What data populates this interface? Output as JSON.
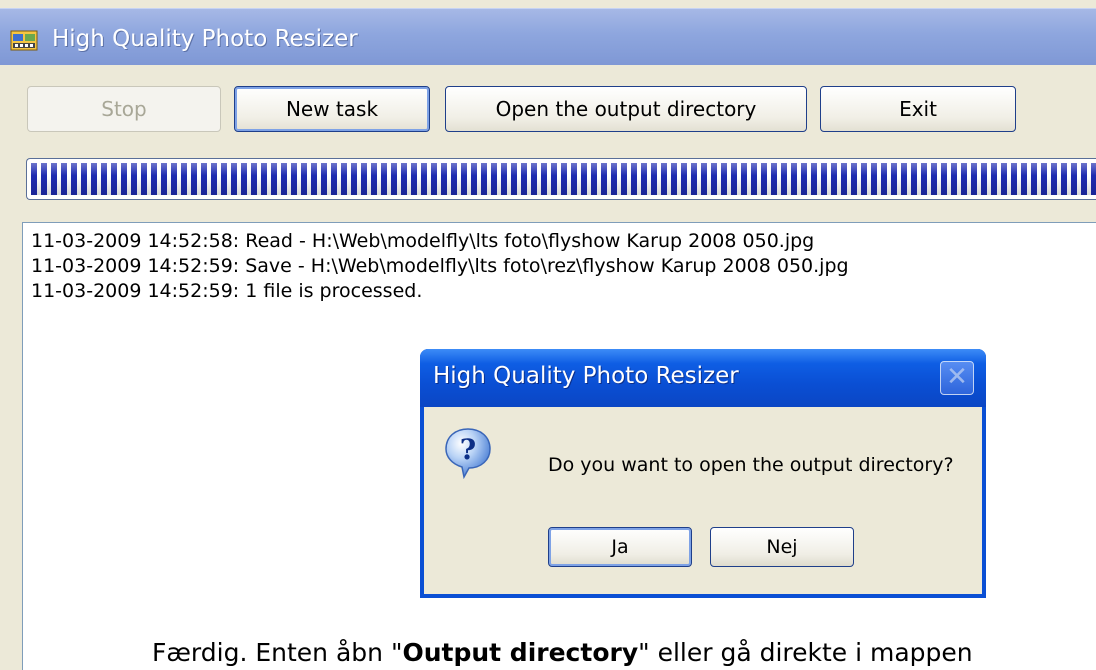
{
  "window": {
    "title": "High Quality Photo Resizer"
  },
  "toolbar": {
    "stop_label": "Stop",
    "new_task_label": "New task",
    "open_output_label": "Open the output directory",
    "exit_label": "Exit"
  },
  "progress": {
    "value_percent": 100
  },
  "log": {
    "lines": [
      "11-03-2009 14:52:58: Read - H:\\Web\\modelfly\\lts foto\\flyshow Karup 2008 050.jpg",
      "11-03-2009 14:52:59: Save - H:\\Web\\modelfly\\lts foto\\rez\\flyshow Karup 2008 050.jpg",
      "11-03-2009 14:52:59: 1 file is processed."
    ]
  },
  "caption": {
    "before": "Færdig. Enten åbn \"",
    "bold": "Output directory",
    "after": "\" eller gå direkte i mappen"
  },
  "dialog": {
    "title": "High Quality Photo Resizer",
    "message": "Do you want to open the output directory?",
    "yes_label": "Ja",
    "no_label": "Nej",
    "icon": "question-icon"
  },
  "colors": {
    "progress_blocks": "#1f2bb0",
    "dialog_title": "#0a4fd4",
    "window_bg": "#ece9d8"
  }
}
